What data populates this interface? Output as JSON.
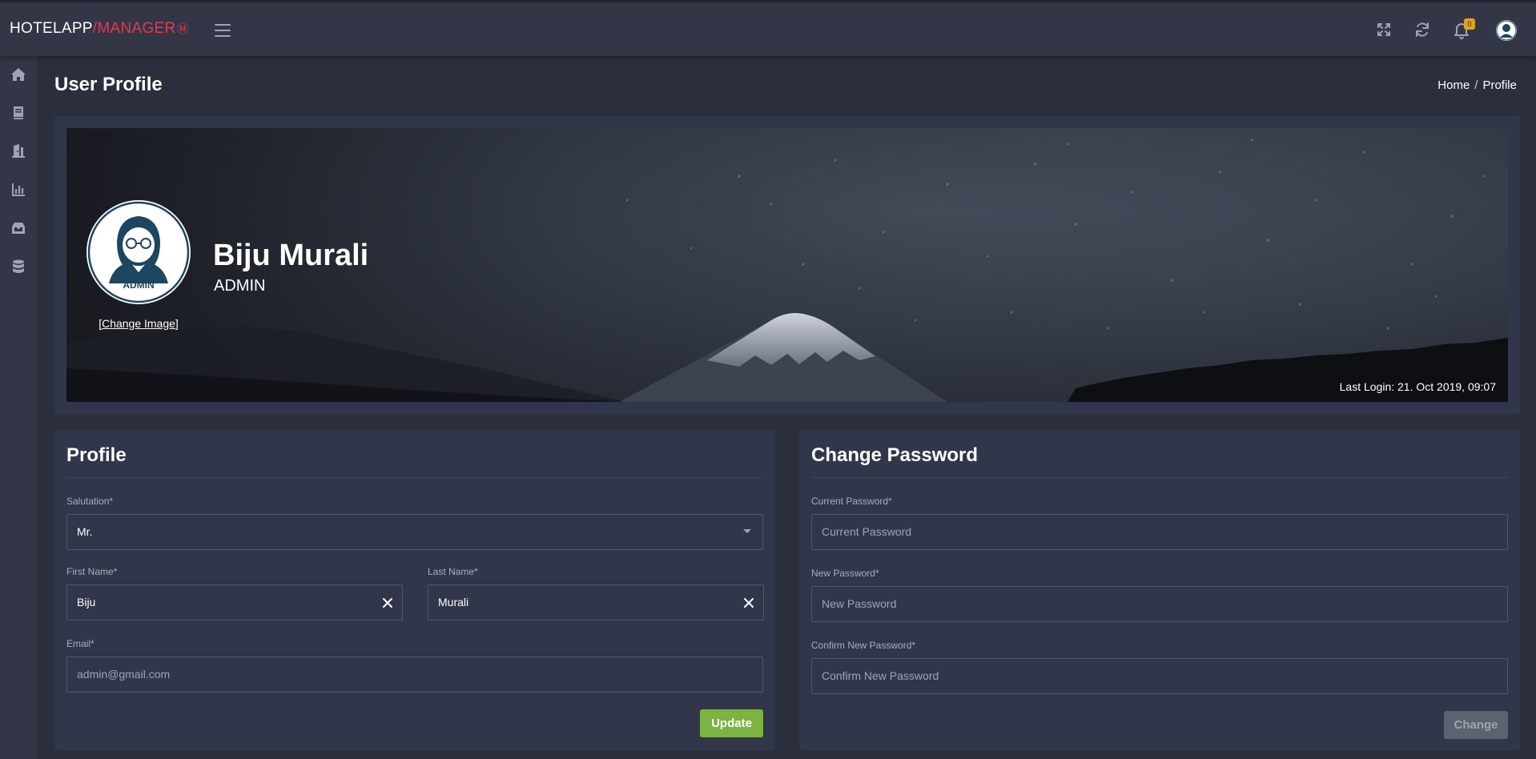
{
  "app": {
    "logo_part1": "HOTELAPP",
    "logo_part2": "/MANAGER",
    "notification_count": "0"
  },
  "icons": {
    "topbar": [
      "menu-icon",
      "fullscreen-icon",
      "refresh-icon",
      "bell-icon",
      "user-avatar-icon"
    ],
    "sidebar": [
      "home-icon",
      "book-icon",
      "door-icon",
      "bar-chart-icon",
      "inbox-icon",
      "database-icon"
    ]
  },
  "page": {
    "title": "User Profile",
    "breadcrumb_home": "Home",
    "breadcrumb_sep": "/",
    "breadcrumb_current": "Profile"
  },
  "banner": {
    "name": "Biju Murali",
    "role": "ADMIN",
    "avatar_badge": "ADMIN",
    "change_image": "[Change Image]",
    "last_login": "Last Login: 21. Oct 2019, 09:07"
  },
  "profile_form": {
    "title": "Profile",
    "salutation_label": "Salutation*",
    "salutation_value": "Mr.",
    "first_name_label": "First Name*",
    "first_name_value": "Biju",
    "last_name_label": "Last Name*",
    "last_name_value": "Murali",
    "email_label": "Email*",
    "email_value": "admin@gmail.com",
    "update_button": "Update"
  },
  "password_form": {
    "title": "Change Password",
    "current_label": "Current Password*",
    "current_placeholder": "Current Password",
    "new_label": "New Password*",
    "new_placeholder": "New Password",
    "confirm_label": "Confirm New Password*",
    "confirm_placeholder": "Confirm New Password",
    "change_button": "Change"
  },
  "colors": {
    "background": "#2b2e3c",
    "panel": "#32364a",
    "accent_red": "#e8384f",
    "update_green": "#7cb342",
    "badge_yellow": "#e2a318",
    "avatar_navy": "#1d4660"
  }
}
